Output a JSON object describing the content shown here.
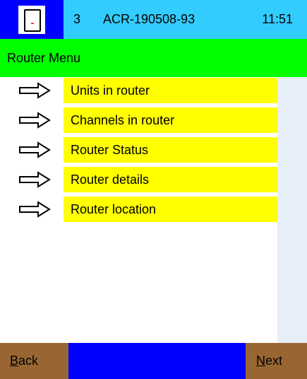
{
  "status": {
    "channel": "3",
    "unit_id": "ACR-190508-93",
    "time": "11:51",
    "battery_icon": "battery-icon",
    "battery_mark": "-"
  },
  "header": {
    "title": "Router Menu"
  },
  "menu": {
    "items": [
      {
        "label": "Units in router",
        "icon": "arrow-right-icon"
      },
      {
        "label": "Channels in router",
        "icon": "arrow-right-icon"
      },
      {
        "label": "Router Status",
        "icon": "arrow-right-icon"
      },
      {
        "label": "Router details",
        "icon": "arrow-right-icon"
      },
      {
        "label": "Router location",
        "icon": "arrow-right-icon"
      }
    ]
  },
  "footer": {
    "back": {
      "key": "B",
      "rest": "ack"
    },
    "next": {
      "key": "N",
      "rest": "ext"
    }
  },
  "colors": {
    "statusbar": "#33ccff",
    "device_bg": "#0000ff",
    "titlebar": "#00ff00",
    "menu_item": "#ffff00",
    "side_panel": "#e6eef7",
    "footer": "#0000ff",
    "nav_button": "#996633",
    "battery_mark": "#ff0000"
  }
}
